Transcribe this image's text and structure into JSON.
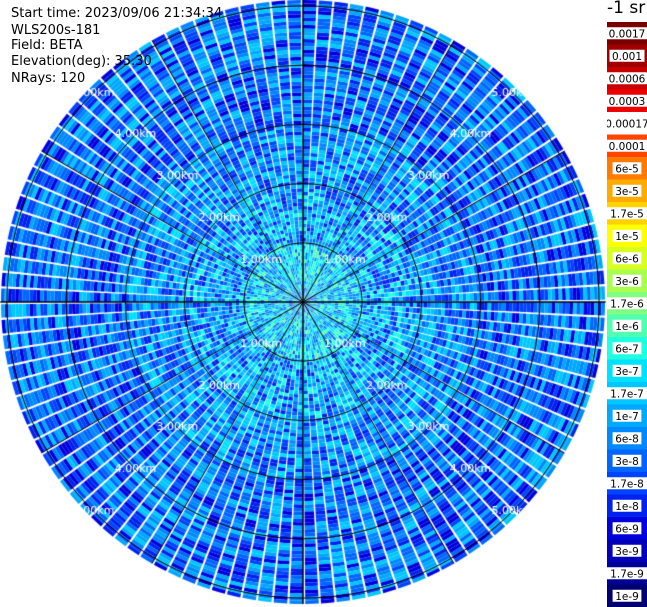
{
  "header": {
    "start_time": "Start time: 2023/09/06 21:34:34",
    "instrument": "WLS200s-181",
    "field": "Field: BETA",
    "elevation": "Elevation(deg): 35.30",
    "nrays": "NRays: 120"
  },
  "colorbar": {
    "unit_label": "-1 sr",
    "ticks": [
      "0.0017",
      "0.001",
      "0.0006",
      "0.0003",
      "0.00017",
      "0.0001",
      "6e-5",
      "3e-5",
      "1.7e-5",
      "1e-5",
      "6e-6",
      "3e-6",
      "1.7e-6",
      "1e-6",
      "6e-7",
      "3e-7",
      "1.7e-7",
      "1e-7",
      "6e-8",
      "3e-8",
      "1.7e-8",
      "1e-8",
      "6e-9",
      "3e-9",
      "1.7e-9",
      "1e-9"
    ],
    "colors": [
      "#7a0000",
      "#a00000",
      "#c80000",
      "#ee0000",
      "#ffffff",
      "#ff4500",
      "#ff7a00",
      "#ffaa00",
      "#ffd200",
      "#ffff00",
      "#d8ff20",
      "#a8ff50",
      "#80ff80",
      "#50ffb0",
      "#20ffe0",
      "#00e0ff",
      "#00c8ff",
      "#00a8ff",
      "#0088ff",
      "#0066ff",
      "#0044ff",
      "#0022ee",
      "#0000dd",
      "#0000bb",
      "#000099",
      "#000070"
    ]
  },
  "chart_data": {
    "type": "heatmap",
    "subtype": "polar PPI scan",
    "field": "BETA",
    "elevation_deg": 35.3,
    "n_rays": 120,
    "range_rings_km": [
      1.0,
      2.0,
      3.0,
      4.0,
      5.0
    ],
    "ring_labels": [
      "1.00km",
      "2.00km",
      "3.00km",
      "4.00km",
      "5.00km"
    ],
    "spoke_angles_deg": [
      0,
      30,
      60,
      90,
      120,
      150,
      180,
      210,
      240,
      270,
      300,
      330
    ],
    "max_range_km": 5.1,
    "dominant_values_by_range": [
      {
        "range_km": "0-1",
        "beta": "3e-7 to 1e-6"
      },
      {
        "range_km": "1-2",
        "beta": "1e-7 to 6e-7"
      },
      {
        "range_km": "2-3",
        "beta": "3e-8 to 1.7e-7"
      },
      {
        "range_km": "3-5",
        "beta": "1e-8 to 1e-7"
      }
    ]
  }
}
